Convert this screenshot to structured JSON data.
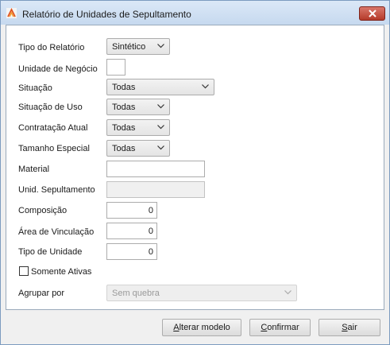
{
  "window": {
    "title": "Relatório de Unidades de Sepultamento",
    "icon": "app-logo-icon",
    "close_icon": "close-icon",
    "accent_color": "#c9402f"
  },
  "form": {
    "tipo_relatorio": {
      "label": "Tipo do Relatório",
      "value": "Sintético"
    },
    "unidade_negocio": {
      "label": "Unidade de Negócio",
      "value": ""
    },
    "situacao": {
      "label": "Situação",
      "value": "Todas"
    },
    "situacao_uso": {
      "label": "Situação de Uso",
      "value": "Todas"
    },
    "contratacao_atual": {
      "label": "Contratação Atual",
      "value": "Todas"
    },
    "tamanho_especial": {
      "label": "Tamanho Especial",
      "value": "Todas"
    },
    "material": {
      "label": "Material",
      "value": ""
    },
    "unid_sepultamento": {
      "label": "Unid. Sepultamento",
      "value": ""
    },
    "composicao": {
      "label": "Composição",
      "value": "0"
    },
    "area_vinculacao": {
      "label": "Área de Vinculação",
      "value": "0"
    },
    "tipo_unidade": {
      "label": "Tipo de Unidade",
      "value": "0"
    },
    "somente_ativas": {
      "label": "Somente Ativas",
      "checked": false
    },
    "agrupar_por": {
      "label": "Agrupar por",
      "value": "Sem quebra"
    }
  },
  "buttons": {
    "alterar_modelo": {
      "mnemonic": "A",
      "rest": "lterar modelo"
    },
    "confirmar": {
      "mnemonic": "C",
      "rest": "onfirmar"
    },
    "sair": {
      "mnemonic": "S",
      "rest": "air"
    }
  }
}
